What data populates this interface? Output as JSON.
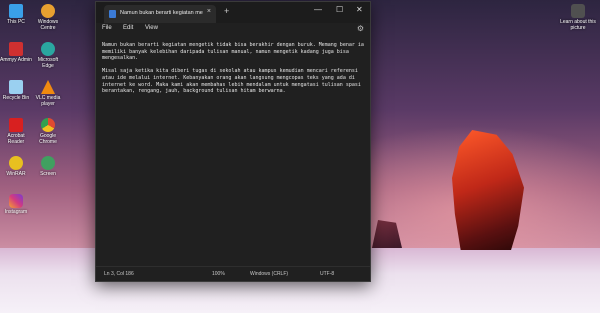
{
  "desktop": {
    "icons_left": [
      {
        "label": "This PC",
        "color": "#3aa0e8"
      },
      {
        "label": "Windows Centre",
        "color": "#e8a030"
      },
      {
        "label": "Ammyy Admin",
        "color": "#d03030"
      },
      {
        "label": "Microsoft Edge",
        "color": "#2aa7a0"
      },
      {
        "label": "Recycle Bin",
        "color": "#9ad0f0"
      },
      {
        "label": "VLC media player",
        "color": "#f08a10"
      },
      {
        "label": "Acrobat Reader",
        "color": "#d82020"
      },
      {
        "label": "Google Chrome",
        "color": "#e04a30"
      },
      {
        "label": "WinRAR",
        "color": "#e8c020"
      },
      {
        "label": "Screen",
        "color": "#40a060"
      },
      {
        "label": "Instagram",
        "color": "#d23a80"
      }
    ],
    "icon_right": {
      "label": "Learn about this picture",
      "color": "#505050"
    }
  },
  "notepad": {
    "tab_title": "Namun bukan berarti kegiatan me",
    "tab_close": "×",
    "new_tab": "+",
    "controls": {
      "minimize": "—",
      "maximize": "☐",
      "close": "✕"
    },
    "menu": {
      "file": "File",
      "edit": "Edit",
      "view": "View"
    },
    "settings_icon": "⚙",
    "body": {
      "para1": "Namun bukan berarti kegiatan mengetik tidak bisa berakhir dengan buruk. Memang benar ia memiliki banyak kelebihan daripada tulisan manual, namun mengetik kadang juga bisa mengesalkan.",
      "para2": "Misal saja ketika kita diberi tugas di sekolah atau kampus kemudian mencari referensi atau ide melalui internet. Kebanyakan orang akan langsung mengcopas teks yang ada di internet ke word. Maka kami akan membahas lebih mendalam untuk mengatasi tulisan spasi berantakan, rengang, jauh, background tulisan hitam berwarna."
    },
    "status": {
      "position": "Ln 3, Col 186",
      "zoom": "100%",
      "line_ending": "Windows (CRLF)",
      "encoding": "UTF-8"
    }
  }
}
